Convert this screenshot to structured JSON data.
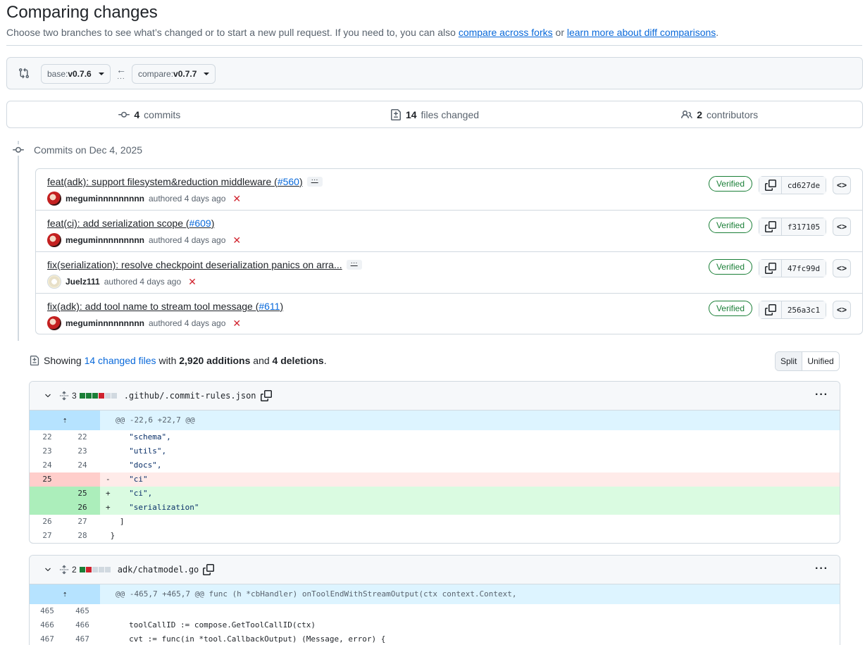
{
  "header": {
    "title": "Comparing changes",
    "subtitle_prefix": "Choose two branches to see what’s changed or to start a new pull request. If you need to, you can also ",
    "link_forks": "compare across forks",
    "subtitle_mid": " or ",
    "link_learn": "learn more about diff comparisons",
    "subtitle_end": "."
  },
  "range": {
    "base_label": "base: ",
    "base_value": "v0.7.6",
    "compare_label": "compare: ",
    "compare_value": "v0.7.7"
  },
  "summary": {
    "commits_count": "4",
    "commits_label": "commits",
    "files_count": "14",
    "files_label": "files changed",
    "contributors_count": "2",
    "contributors_label": "contributors"
  },
  "commits_heading": "Commits on Dec 4, 2025",
  "commits": [
    {
      "title": "feat(adk): support filesystem&reduction middleware (",
      "pr": "#560",
      "close": ")",
      "has_more": true,
      "author": "meguminnnnnnnnn",
      "authored": "authored 4 days ago",
      "verified": "Verified",
      "sha": "cd627de"
    },
    {
      "title": "feat(ci): add serialization scope (",
      "pr": "#609",
      "close": ")",
      "has_more": false,
      "author": "meguminnnnnnnnn",
      "authored": "authored 4 days ago",
      "verified": "Verified",
      "sha": "f317105"
    },
    {
      "title": "fix(serialization): resolve checkpoint deserialization panics on arra...",
      "pr": "",
      "close": "",
      "has_more": true,
      "author": "Juelz111",
      "authored": "authored 4 days ago",
      "verified": "Verified",
      "sha": "47fc99d"
    },
    {
      "title": "fix(adk): add tool name to stream tool message (",
      "pr": "#611",
      "close": ")",
      "has_more": false,
      "author": "meguminnnnnnnnn",
      "authored": "authored 4 days ago",
      "verified": "Verified",
      "sha": "256a3c1"
    }
  ],
  "showing": {
    "prefix": "Showing ",
    "link": "14 changed files",
    "with": " with ",
    "additions": "2,920 additions",
    "and": " and ",
    "deletions": "4 deletions",
    "end": "."
  },
  "view_toggle": {
    "split": "Split",
    "unified": "Unified",
    "selected": "Unified"
  },
  "files": [
    {
      "count": "3",
      "diffstat": [
        "add",
        "add",
        "add",
        "del",
        "neu"
      ],
      "name": ".github/.commit-rules.json",
      "hunk": "@@ -22,6 +22,7 @@",
      "lines": [
        {
          "type": "ctx",
          "old": "22",
          "new": "22",
          "sign": " ",
          "code": "    \"schema\","
        },
        {
          "type": "ctx",
          "old": "23",
          "new": "23",
          "sign": " ",
          "code": "    \"utils\","
        },
        {
          "type": "ctx",
          "old": "24",
          "new": "24",
          "sign": " ",
          "code": "    \"docs\","
        },
        {
          "type": "del",
          "old": "25",
          "new": "",
          "sign": "-",
          "code": "    \"ci\""
        },
        {
          "type": "add",
          "old": "",
          "new": "25",
          "sign": "+",
          "code": "    \"ci\","
        },
        {
          "type": "add",
          "old": "",
          "new": "26",
          "sign": "+",
          "code": "    \"serialization\""
        },
        {
          "type": "ctx",
          "old": "26",
          "new": "27",
          "sign": " ",
          "code": "  ]"
        },
        {
          "type": "ctx",
          "old": "27",
          "new": "28",
          "sign": " ",
          "code": "}"
        }
      ]
    },
    {
      "count": "2",
      "diffstat": [
        "add",
        "del",
        "neu",
        "neu",
        "neu"
      ],
      "name": "adk/chatmodel.go",
      "hunk": "@@ -465,7 +465,7 @@ func (h *cbHandler) onToolEndWithStreamOutput(ctx context.Context,",
      "lines": [
        {
          "type": "ctx",
          "old": "465",
          "new": "465",
          "sign": " ",
          "code": ""
        },
        {
          "type": "ctx",
          "old": "466",
          "new": "466",
          "sign": " ",
          "code": "    toolCallID := compose.GetToolCallID(ctx)"
        },
        {
          "type": "ctx",
          "old": "467",
          "new": "467",
          "sign": " ",
          "code": "    cvt := func(in *tool.CallbackOutput) (Message, error) {"
        }
      ]
    }
  ],
  "colors": {
    "link": "#0969da",
    "verified": "#1a7f37",
    "addition": "#1a7f37",
    "deletion": "#cf222e",
    "hunk_bg": "#ddf4ff"
  }
}
